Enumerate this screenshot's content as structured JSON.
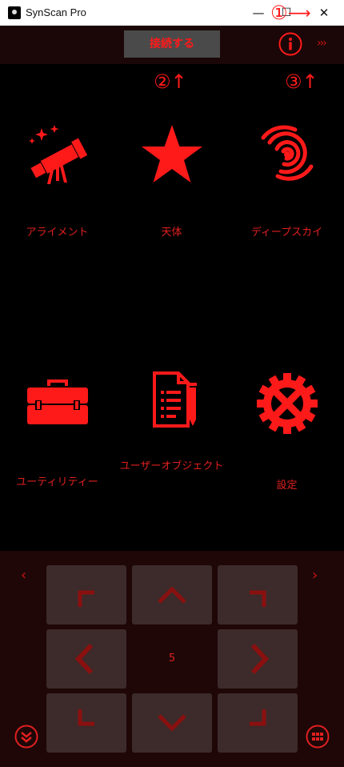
{
  "window": {
    "title": "SynScan Pro",
    "minimize": "—",
    "maximize": "☐",
    "close": "✕"
  },
  "annotations": {
    "a1": "①",
    "a1_arrow": "⟶",
    "a2": "②↑",
    "a3": "③↑"
  },
  "toolbar": {
    "connect_label": "接続する",
    "more_label": "›››"
  },
  "menu": {
    "alignment": "アライメント",
    "objects": "天体",
    "deep_sky": "ディープスカイ",
    "utility": "ユーティリティー",
    "user_objects": "ユーザーオブジェクト",
    "settings": "設定"
  },
  "hand_control": {
    "speed": "5"
  },
  "colors": {
    "accent": "#ff1a1a",
    "pad": "#3d2a2a",
    "panel": "#1f0707",
    "toolbar": "#1b0707"
  }
}
